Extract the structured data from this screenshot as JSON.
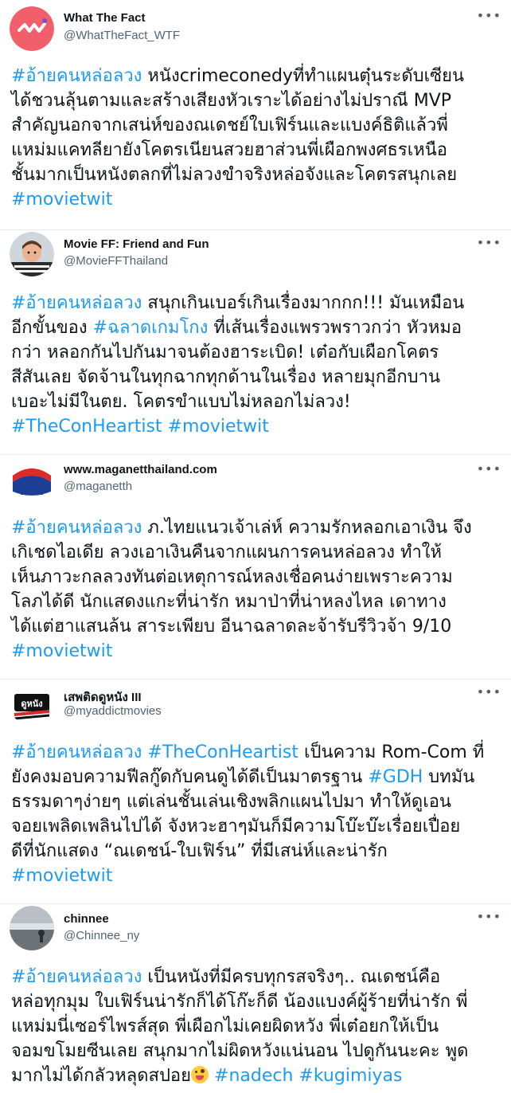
{
  "tweets": [
    {
      "name": "What The Fact",
      "handle": "@WhatTheFact_WTF",
      "avatar_icon": "what-the-fact-logo",
      "more": "•••",
      "lines": [
        [
          {
            "t": "#อ้ายคนหล่อลวง",
            "tag": true
          },
          {
            "t": " หนังcrimeconedyที่ทำแผนตุ๋นระดับเซียน"
          }
        ],
        [
          {
            "t": "ได้ชวนลุ้นตามและสร้างเสียงหัวเราะได้อย่างไม่ปราณี MVP"
          }
        ],
        [
          {
            "t": "สำคัญนอกจากเสน่ห์ของณเดชย์ใบเฟิร์นและแบงค์ธิติแล้วพี่"
          }
        ],
        [
          {
            "t": "แหม่มแคทลียายังโคตรเนียนสวยฮาส่วนพี่เผือกพงศธรเหนือ"
          }
        ],
        [
          {
            "t": "ชั้นมากเป็นหนังตลกที่ไม่ลวงขำจริงหล่อจังและโคตรสนุกเลย"
          }
        ],
        [
          {
            "t": "#movietwit",
            "tag": true
          }
        ]
      ]
    },
    {
      "name": "Movie FF: Friend and Fun",
      "handle": "@MovieFFThailand",
      "avatar_icon": "movie-ff-avatar",
      "more": "•••",
      "lines": [
        [
          {
            "t": "#อ้ายคนหล่อลวง",
            "tag": true
          },
          {
            "t": " สนุกเกินเบอร์เกินเรื่องมากกก!!! มันเหมือน"
          }
        ],
        [
          {
            "t": "อีกขั้นของ "
          },
          {
            "t": "#ฉลาดเกมโกง",
            "tag": true
          },
          {
            "t": " ที่เส้นเรื่องแพรวพราวกว่า หัวหมอ"
          }
        ],
        [
          {
            "t": "กว่า หลอกกันไปกันมาจนต้องฮาระเบิด! เต๋อกับเผือกโคตร"
          }
        ],
        [
          {
            "t": "สีสันเลย จัดจ้านในทุกฉากทุกด้านในเรื่อง หลายมุกอีกบาน"
          }
        ],
        [
          {
            "t": "เบอะไม่มีในตย. โคตรขำแบบไม่หลอกไม่ลวง!"
          }
        ],
        [
          {
            "t": "#TheConHeartist",
            "tag": true
          },
          {
            "t": " "
          },
          {
            "t": "#movietwit",
            "tag": true
          }
        ]
      ]
    },
    {
      "name": "www.maganetthailand.com",
      "handle": "@maganetth",
      "avatar_icon": "maganet-logo",
      "more": "•••",
      "lines": [
        [
          {
            "t": "#อ้ายคนหล่อลวง",
            "tag": true
          },
          {
            "t": " ภ.ไทยแนวเจ้าเล่ห์ ความรักหลอกเอาเงิน จึง"
          }
        ],
        [
          {
            "t": "เกิเชดไอเดีย ลวงเอาเงินคืนจากแผนการคนหล่อลวง ทำให้"
          }
        ],
        [
          {
            "t": "เห็นภาวะกลลวงทันต่อเหตุการณ์หลงเชื่อคนง่ายเพราะความ"
          }
        ],
        [
          {
            "t": "โลภได้ดี นักแสดงแกะที่น่ารัก หมาป่าที่น่าหลงไหล เดาทาง"
          }
        ],
        [
          {
            "t": "ได้แต่ฮาแสนล้น สาระเพียบ อีนาฉลาดละจ้ารับรีวิวจ้า 9/10"
          }
        ],
        [
          {
            "t": "#movietwit",
            "tag": true
          }
        ]
      ]
    },
    {
      "name": "เสพติดดูหนัง III",
      "handle": "@myaddictmovies",
      "avatar_icon": "addict-movies-logo",
      "more": "•••",
      "lines": [
        [
          {
            "t": "#อ้ายคนหล่อลวง",
            "tag": true
          },
          {
            "t": " "
          },
          {
            "t": "#TheConHeartist",
            "tag": true
          },
          {
            "t": " เป็นความ Rom-Com ที่"
          }
        ],
        [
          {
            "t": "ยังคงมอบความฟีลกู๊ดกับคนดูได้ดีเป็นมาตรฐาน "
          },
          {
            "t": "#GDH",
            "tag": true
          },
          {
            "t": " บทมัน"
          }
        ],
        [
          {
            "t": "ธรรมดาๆง่ายๆ แต่เล่นชั้นเล่นเชิงพลิกแผนไปมา ทำให้ดูเอน"
          }
        ],
        [
          {
            "t": "จอยเพลิดเพลินไปได้ จังหวะฮาๆมันก็มีความโบ๊ะบ๊ะเรื่อยเปื่อย"
          }
        ],
        [
          {
            "t": "ดีที่นักแสดง “ณเดชน์-ใบเฟิร์น” ที่มีเสน่ห์และน่ารัก"
          }
        ],
        [
          {
            "t": "#movietwit",
            "tag": true
          }
        ]
      ]
    },
    {
      "name": "chinnee",
      "handle": "@Chinnee_ny",
      "avatar_icon": "chinnee-avatar",
      "more": "•••",
      "lines": [
        [
          {
            "t": "#อ้ายคนหล่อลวง",
            "tag": true
          },
          {
            "t": " เป็นหนังที่มีครบทุกรสจริงๆ.. ณเดชน์คือ"
          }
        ],
        [
          {
            "t": "หล่อทุกมุม ใบเฟิร์นน่ารักก็ได้โก๊ะก็ดี น้องแบงค์ผู้ร้ายที่น่ารัก พี่"
          }
        ],
        [
          {
            "t": "แหม่มนี่เซอร์ไพรส์สุด พี่เผือกไม่เคยผิดหวัง พี่เต๋อยกให้เป็น"
          }
        ],
        [
          {
            "t": "จอมขโมยซีนเลย สนุกมากไม่ผิดหวังแน่นอน ไปดูกันนะคะ พูด"
          }
        ],
        [
          {
            "t": "มากไม่ได้กลัวหลุดสปอย"
          },
          {
            "emoji": "winking-face-with-tongue"
          },
          {
            "t": " "
          },
          {
            "t": "#nadech",
            "tag": true
          },
          {
            "t": " "
          },
          {
            "t": "#kugimiyas",
            "tag": true
          }
        ]
      ]
    }
  ]
}
